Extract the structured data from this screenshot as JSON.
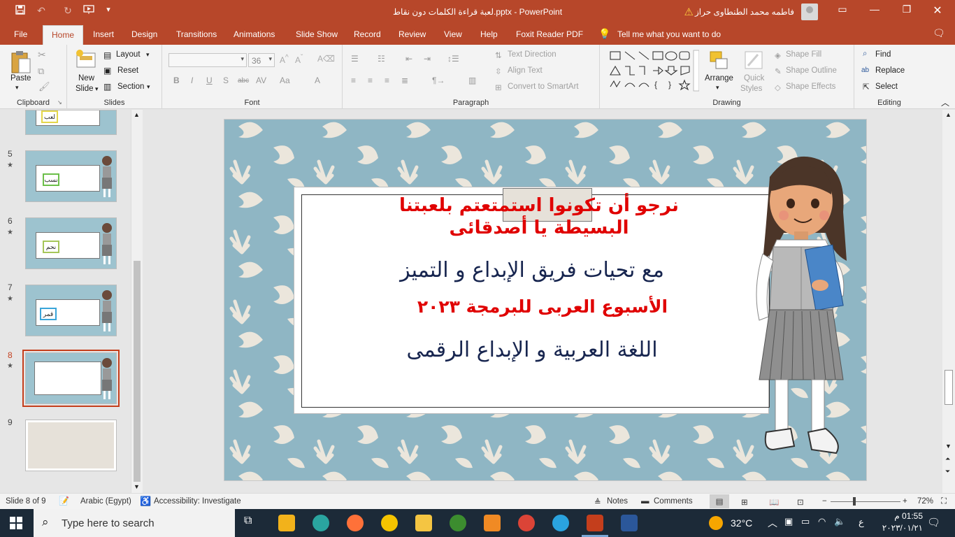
{
  "titlebar": {
    "doc_title": "لعبة قراءة الكلمات دون نقاط.pptx  -  PowerPoint",
    "user_name": "فاطمه محمد الطنطاوى حراز"
  },
  "tabs": [
    "File",
    "Home",
    "Insert",
    "Design",
    "Transitions",
    "Animations",
    "Slide Show",
    "Record",
    "Review",
    "View",
    "Help",
    "Foxit Reader PDF"
  ],
  "tell_me": "Tell me what you want to do",
  "ribbon": {
    "clipboard": {
      "paste": "Paste",
      "label": "Clipboard"
    },
    "slides": {
      "new_slide_1": "New",
      "new_slide_2": "Slide",
      "layout": "Layout",
      "reset": "Reset",
      "section": "Section",
      "label": "Slides"
    },
    "font": {
      "size": "36",
      "label": "Font"
    },
    "paragraph": {
      "text_direction": "Text Direction",
      "align_text": "Align Text",
      "smartart": "Convert to SmartArt",
      "label": "Paragraph"
    },
    "drawing": {
      "arrange": "Arrange",
      "quick_styles_1": "Quick",
      "quick_styles_2": "Styles",
      "shape_fill": "Shape Fill",
      "shape_outline": "Shape Outline",
      "shape_effects": "Shape Effects",
      "label": "Drawing"
    },
    "editing": {
      "find": "Find",
      "replace": "Replace",
      "select": "Select",
      "label": "Editing"
    }
  },
  "thumbnails": [
    {
      "num": "5",
      "word": "نسب"
    },
    {
      "num": "6",
      "word": "نحم"
    },
    {
      "num": "7",
      "word": "قمر"
    },
    {
      "num": "8",
      "word": ""
    },
    {
      "num": "9",
      "word": ""
    }
  ],
  "top_thumb_word": "لعب",
  "slide": {
    "line1": "نرجو أن تكونوا استمتعتم بلعبتنا",
    "line2": "البسيطة يا أصدقائى",
    "line3": "مع تحيات فريق الإبداع و التميز",
    "line4": "الأسبوع العربى للبرمجة ٢٠٢٣",
    "line5": "اللغة العربية و الإبداع الرقمى"
  },
  "status": {
    "slide_count": "Slide 8 of 9",
    "language": "Arabic (Egypt)",
    "accessibility": "Accessibility: Investigate",
    "notes": "Notes",
    "comments": "Comments",
    "zoom": "72%"
  },
  "taskbar": {
    "search_placeholder": "Type here to search",
    "temperature": "32°C",
    "lang": "ع",
    "time": "01:55 م",
    "date": "٢٠٢٣/٠١/٢١"
  },
  "colors": {
    "accent": "#b7472a",
    "slide_bg": "#8fb6c4",
    "red_text": "#e00000",
    "navy_text": "#17254f"
  }
}
